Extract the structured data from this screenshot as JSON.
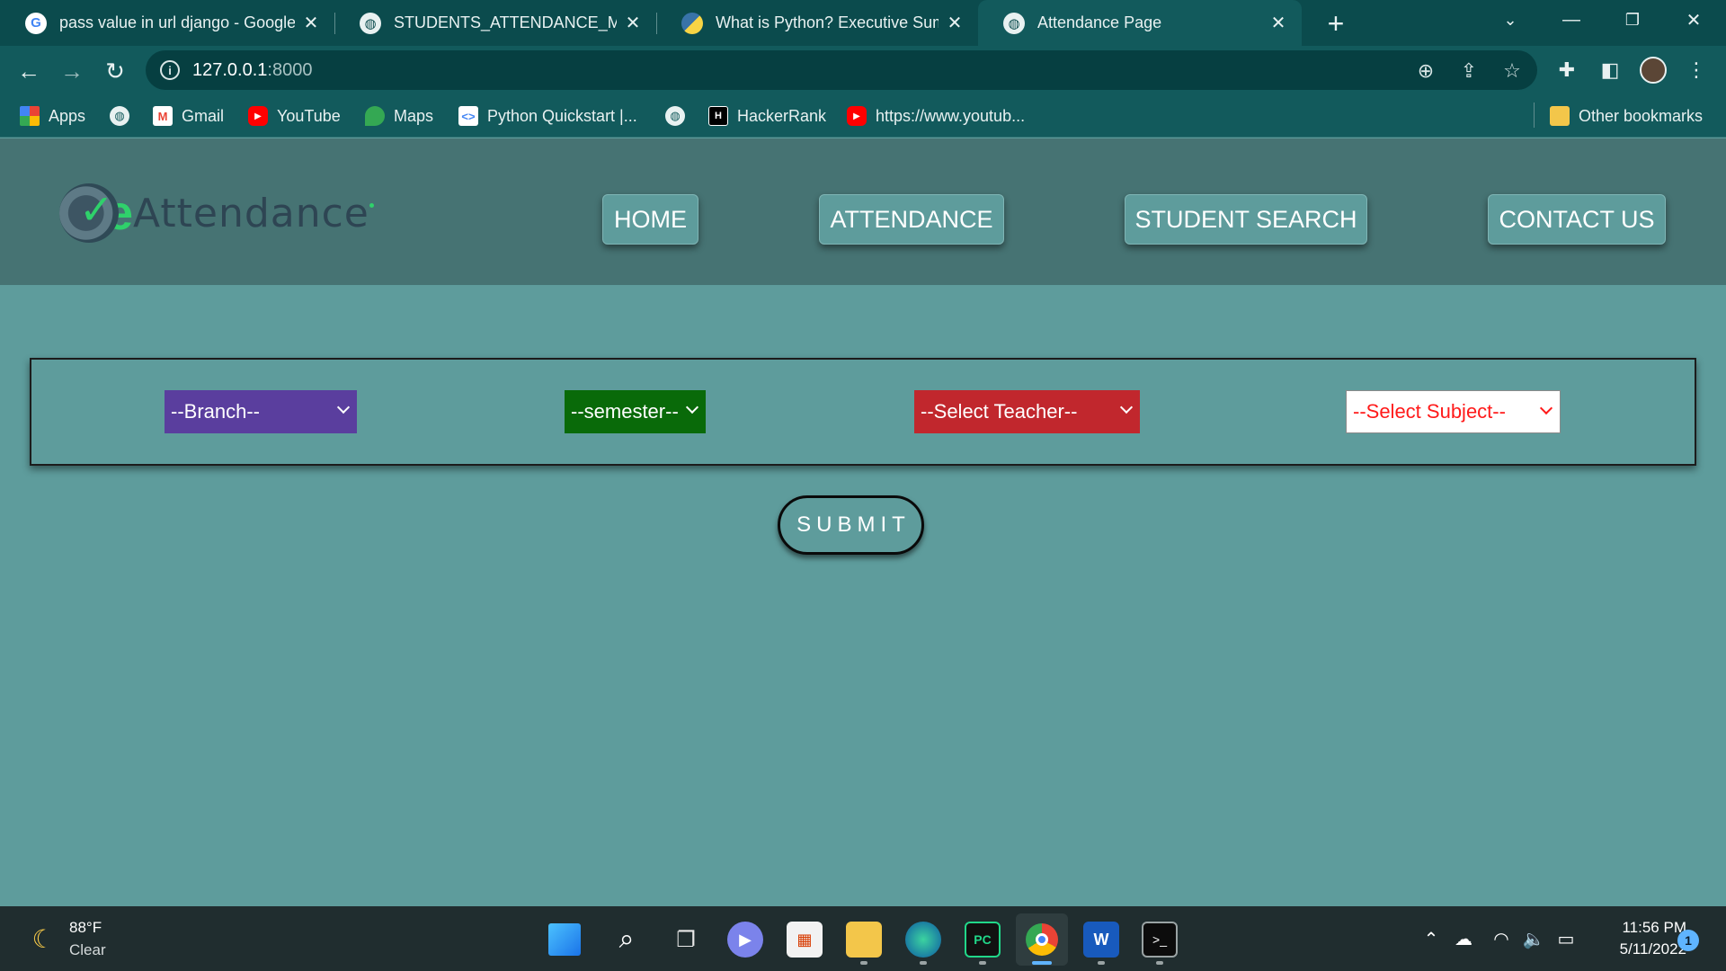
{
  "browser": {
    "tabs": [
      {
        "title": "pass value in url django - Google",
        "icon": "google-icon"
      },
      {
        "title": "STUDENTS_ATTENDANCE_MANA",
        "icon": "globe-icon"
      },
      {
        "title": "What is Python? Executive Summ",
        "icon": "python-icon"
      },
      {
        "title": "Attendance Page",
        "icon": "globe-icon",
        "active": true
      }
    ],
    "address": {
      "host": "127.0.0.1",
      "port": ":8000"
    },
    "bookmarks": [
      {
        "label": "Apps",
        "icon": "apps-grid-icon"
      },
      {
        "label": "",
        "icon": "globe-icon"
      },
      {
        "label": "Gmail",
        "icon": "gmail-icon",
        "glyph": "M"
      },
      {
        "label": "YouTube",
        "icon": "youtube-icon",
        "glyph": "▶"
      },
      {
        "label": "Maps",
        "icon": "maps-pin-icon"
      },
      {
        "label": "Python Quickstart  |...",
        "icon": "python-quickstart-icon",
        "glyph": "<>"
      },
      {
        "label": "",
        "icon": "globe-icon"
      },
      {
        "label": "HackerRank",
        "icon": "hackerrank-icon",
        "glyph": "H"
      },
      {
        "label": "https://www.youtub...",
        "icon": "youtube-icon",
        "glyph": "▶"
      }
    ],
    "other_bookmarks": "Other bookmarks"
  },
  "page": {
    "logo_text": "Attendance",
    "nav": [
      "HOME",
      "ATTENDANCE",
      "STUDENT SEARCH",
      "CONTACT US"
    ],
    "filters": {
      "branch": "--Branch--",
      "semester": "--semester--",
      "teacher": "--Select Teacher--",
      "subject": "--Select Subject--"
    },
    "submit_label": "SUBMIT"
  },
  "colors": {
    "page_bg": "#5e9c9c",
    "header_bg": "#467373",
    "branch_select": "#5a3e9e",
    "semester_select": "#096a09",
    "teacher_select": "#c1272d",
    "subject_text": "#ff1a1a",
    "logo_accent": "#2fd16b"
  },
  "taskbar": {
    "weather": {
      "temp": "88°F",
      "condition": "Clear"
    },
    "clock": {
      "time": "11:56 PM",
      "date": "5/11/2022"
    },
    "notifications": "1"
  }
}
